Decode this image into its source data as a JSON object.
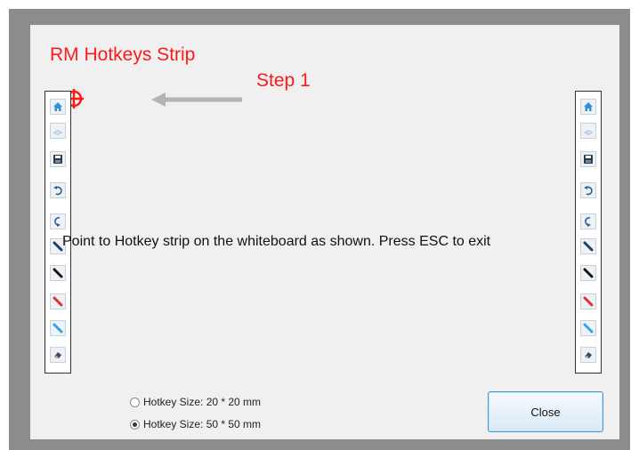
{
  "dialog": {
    "title": "RM Hotkeys Strip",
    "step": "Step 1",
    "instruction": "Point to Hotkey strip on the whiteboard as shown. Press ESC to exit"
  },
  "hotkey_icons": [
    "home-icon",
    "blank-page-icon",
    "save-icon",
    "undo-icon",
    "redo-icon",
    "pen-dark-blue-icon",
    "pen-black-icon",
    "pen-red-icon",
    "pen-light-blue-icon",
    "eraser-icon"
  ],
  "options": {
    "size_20": "Hotkey Size: 20 * 20 mm",
    "size_50": "Hotkey Size: 50 * 50 mm",
    "selected": "size_50"
  },
  "buttons": {
    "close": "Close"
  },
  "colors": {
    "accent_red": "#ff1a1a",
    "button_border": "#3c9ad8",
    "icon_blue": "#2f8fd8"
  }
}
